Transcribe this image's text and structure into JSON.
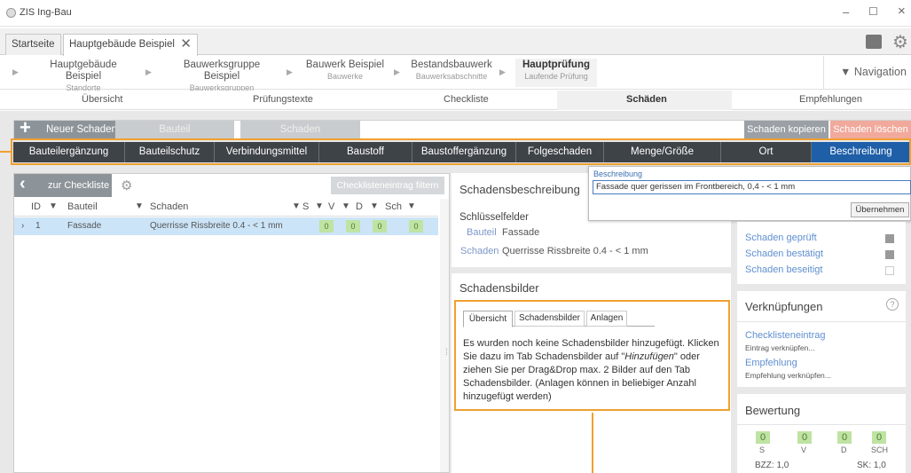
{
  "window": {
    "title": "ZIS Ing-Bau",
    "min": "–",
    "max": "☐",
    "close": "×"
  },
  "tabs": [
    {
      "label": "Startseite"
    },
    {
      "label": "Hauptgebäude Beispiel",
      "close": "✕"
    }
  ],
  "breadcrumb": [
    {
      "title": "Hauptgebäude Beispiel",
      "sub": "Standorte"
    },
    {
      "title": "Bauwerksgruppe Beispiel",
      "sub": "Bauwerksgruppen"
    },
    {
      "title": "Bauwerk Beispiel",
      "sub": "Bauwerke"
    },
    {
      "title": "Bestandsbauwerk",
      "sub": "Bauwerksabschnitte"
    },
    {
      "title": "Hauptprüfung",
      "sub": "Laufende Prüfung"
    }
  ],
  "navigation": "▼ Navigation",
  "subnav": [
    "Übersicht",
    "Prüfungstexte",
    "Checkliste",
    "Schäden",
    "Empfehlungen"
  ],
  "toolbar": {
    "neuer": "Neuer Schaden",
    "bauteil": "Bauteil",
    "schaden": "Schaden",
    "kopieren": "Schaden kopieren",
    "loeschen": "Schaden löschen"
  },
  "categories": [
    "Bauteilergänzung",
    "Bauteilschutz",
    "Verbindungsmittel",
    "Baustoff",
    "Baustoffergänzung",
    "Folgeschaden",
    "Menge/Größe",
    "Ort",
    "Beschreibung"
  ],
  "list": {
    "back": "zur Checkliste",
    "filter": "Checklisteneintrag filtern",
    "headers": [
      "ID",
      "Bauteil",
      "Schaden",
      "S",
      "V",
      "D",
      "Sch"
    ],
    "rows": [
      {
        "id": "1",
        "bauteil": "Fassade",
        "schaden": "Querrisse Rissbreite 0.4 - < 1 mm",
        "s": "0",
        "v": "0",
        "d": "0",
        "sch": "0"
      }
    ]
  },
  "desc": {
    "title": "Schadensbeschreibung",
    "key": "Schlüsselfelder",
    "bauteil_label": "Bauteil",
    "bauteil_val": "Fassade",
    "schaden_label": "Schaden",
    "schaden_val": "Querrisse Rissbreite 0.4 - < 1 mm"
  },
  "popup": {
    "label": "Beschreibung",
    "value": "Fassade quer gerissen im Frontbereich, 0,4 - < 1 mm",
    "btn": "Übernehmen"
  },
  "bilder": {
    "title": "Schadensbilder",
    "tabs": [
      "Übersicht",
      "Schadensbilder",
      "Anlagen"
    ],
    "text1": "Es wurden noch keine Schadensbilder hinzugefügt. Klicken Sie dazu im Tab Schadensbilder auf \"",
    "text_em": "Hinzufügen",
    "text2": "\" oder ziehen Sie per Drag&Drop max. 2 Bilder auf den Tab Schadensbilder. (Anlagen können in beliebiger Anzahl hinzugefügt werden)"
  },
  "status": [
    {
      "label": "Schaden geprüft"
    },
    {
      "label": "Schaden bestätigt"
    },
    {
      "label": "Schaden beseitigt"
    }
  ],
  "verkn": {
    "title": "Verknüpfungen",
    "help": "?",
    "c1": "Checklisteneintrag",
    "c1s": "Eintrag verknüpfen...",
    "c2": "Empfehlung",
    "c2s": "Empfehlung verknüpfen..."
  },
  "bewertung": {
    "title": "Bewertung",
    "vals": [
      {
        "v": "0",
        "l": "S"
      },
      {
        "v": "0",
        "l": "V"
      },
      {
        "v": "0",
        "l": "D"
      },
      {
        "v": "0",
        "l": "SCH"
      }
    ],
    "bzz": "BZZ: 1,0",
    "sk": "SK: 1,0"
  }
}
